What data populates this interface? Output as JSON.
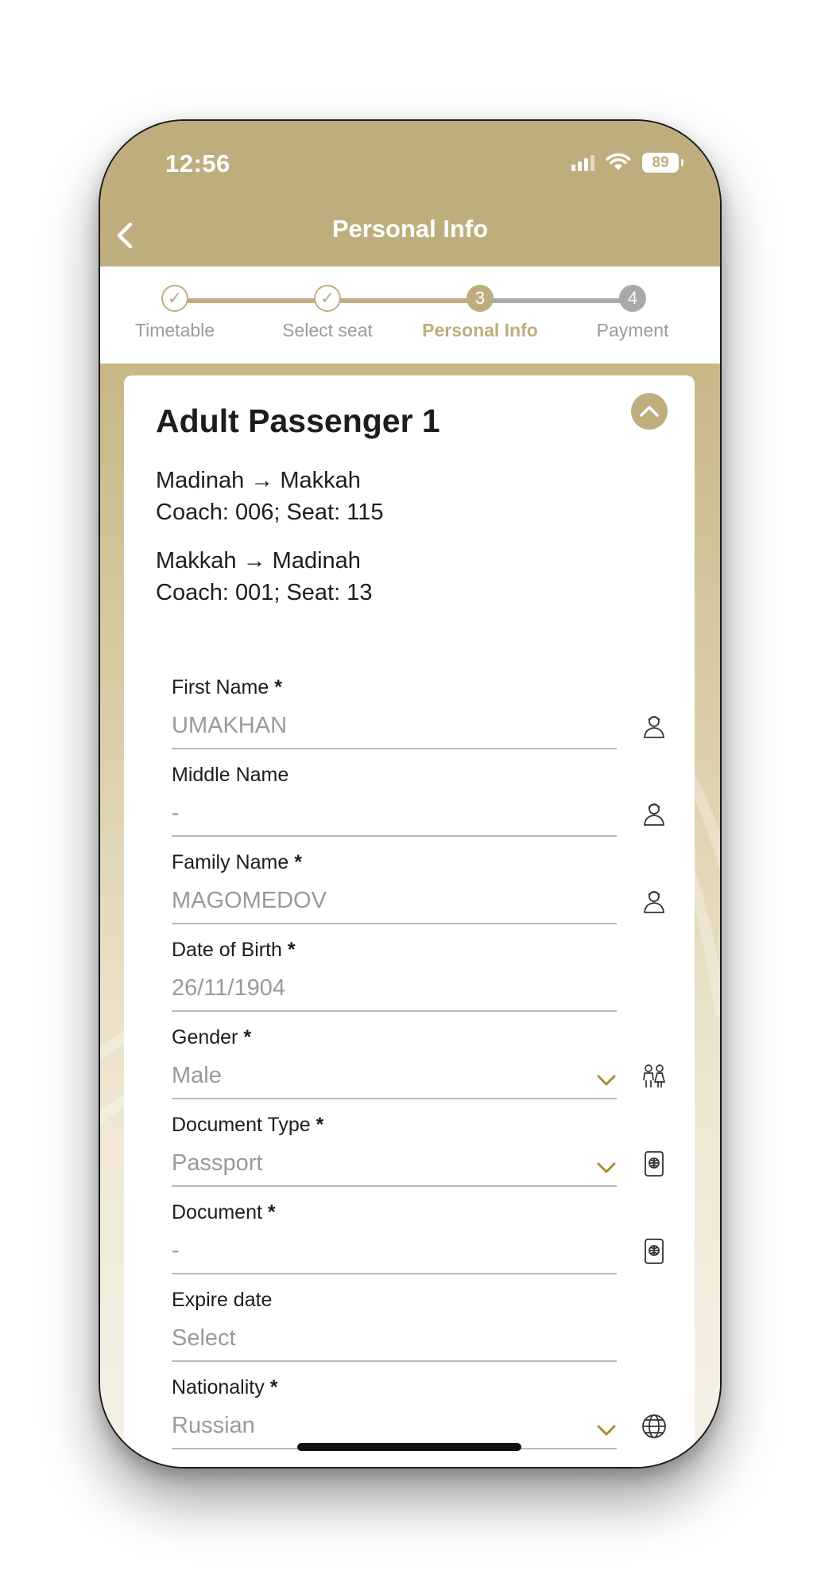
{
  "status_bar": {
    "time": "12:56",
    "battery": "89"
  },
  "header": {
    "title": "Personal Info"
  },
  "steps": [
    {
      "number": "✓",
      "label": "Timetable",
      "state": "done"
    },
    {
      "number": "✓",
      "label": "Select seat",
      "state": "done"
    },
    {
      "number": "3",
      "label": "Personal Info",
      "state": "active"
    },
    {
      "number": "4",
      "label": "Payment",
      "state": "pending"
    }
  ],
  "colors": {
    "brand": "#bfae7d",
    "pending": "#a9a9a9",
    "text": "#1d1d1d",
    "muted": "#9a9a9a"
  },
  "passenger": {
    "title": "Adult Passenger 1",
    "trips": [
      {
        "route": "Madinah → Makkah",
        "details": "Coach: 006; Seat: 115"
      },
      {
        "route": "Makkah → Madinah",
        "details": "Coach: 001; Seat: 13"
      }
    ]
  },
  "fields": {
    "first_name": {
      "label": "First Name",
      "required": "*",
      "value": "UMAKHAN",
      "icon": "person-icon"
    },
    "middle_name": {
      "label": "Middle Name",
      "value": "-",
      "icon": "person-icon"
    },
    "family_name": {
      "label": "Family Name",
      "required": "*",
      "value": "MAGOMEDOV",
      "icon": "person-icon"
    },
    "dob": {
      "label": "Date of Birth",
      "required": "*",
      "value": "26/11/1904"
    },
    "gender": {
      "label": "Gender",
      "required": "*",
      "value": "Male",
      "icon": "family-icon"
    },
    "doc_type": {
      "label": "Document Type",
      "required": "*",
      "value": "Passport",
      "icon": "passport-icon"
    },
    "document": {
      "label": "Document",
      "required": "*",
      "value": "-",
      "icon": "passport-icon"
    },
    "expire": {
      "label": "Expire date",
      "value": "Select"
    },
    "nationality": {
      "label": "Nationality",
      "required": "*",
      "value": "Russian",
      "icon": "globe-icon"
    }
  }
}
